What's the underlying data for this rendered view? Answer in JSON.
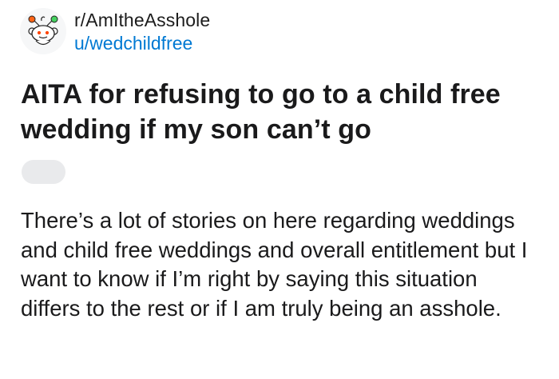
{
  "post": {
    "subreddit": "r/AmItheAsshole",
    "author": "u/wedchildfree",
    "avatar_icon": "snoo-avatar-icon",
    "title": "AITA for refusing to go to a child free wedding if my son can’t go",
    "body": "There’s a lot of stories on here regarding weddings and child free weddings and overall entitlement but I want to know if I’m right by saying this situation differs to the rest or if I am truly being an asshole."
  },
  "colors": {
    "username_link": "#0079d3",
    "text": "#1a1a1b",
    "flair_pill": "#e9eaec"
  }
}
